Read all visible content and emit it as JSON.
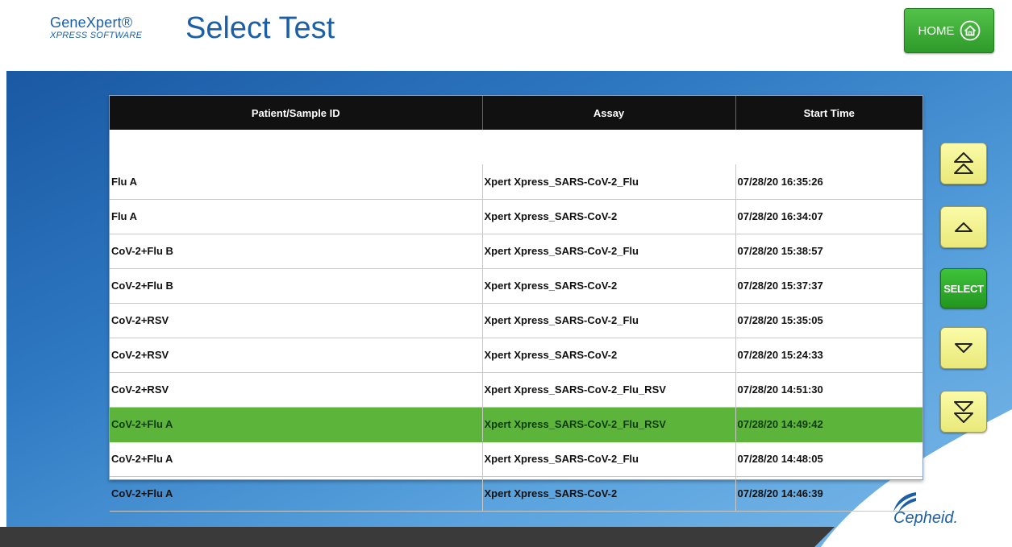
{
  "header": {
    "logo_main": "GeneXpert®",
    "logo_sub": "XPRESS SOFTWARE",
    "title": "Select Test",
    "home_label": "HOME"
  },
  "table": {
    "columns": [
      "Patient/Sample ID",
      "Assay",
      "Start Time"
    ],
    "rows": [
      {
        "id": "Flu A",
        "assay": "Xpert Xpress_SARS-CoV-2_Flu",
        "time": "07/28/20 16:35:26"
      },
      {
        "id": "Flu A",
        "assay": "Xpert Xpress_SARS-CoV-2",
        "time": "07/28/20 16:34:07"
      },
      {
        "id": "CoV-2+Flu B",
        "assay": "Xpert Xpress_SARS-CoV-2_Flu",
        "time": "07/28/20 15:38:57"
      },
      {
        "id": "CoV-2+Flu B",
        "assay": "Xpert Xpress_SARS-CoV-2",
        "time": "07/28/20 15:37:37"
      },
      {
        "id": "CoV-2+RSV",
        "assay": "Xpert Xpress_SARS-CoV-2_Flu",
        "time": "07/28/20 15:35:05"
      },
      {
        "id": "CoV-2+RSV",
        "assay": "Xpert Xpress_SARS-CoV-2",
        "time": "07/28/20 15:24:33"
      },
      {
        "id": "CoV-2+RSV",
        "assay": "Xpert Xpress_SARS-CoV-2_Flu_RSV",
        "time": "07/28/20 14:51:30"
      },
      {
        "id": "CoV-2+Flu A",
        "assay": "Xpert Xpress_SARS-CoV-2_Flu_RSV",
        "time": "07/28/20 14:49:42"
      },
      {
        "id": "CoV-2+Flu A",
        "assay": "Xpert Xpress_SARS-CoV-2_Flu",
        "time": "07/28/20 14:48:05"
      },
      {
        "id": "CoV-2+Flu A",
        "assay": "Xpert Xpress_SARS-CoV-2",
        "time": "07/28/20 14:46:39"
      }
    ],
    "selected_index": 7
  },
  "nav": {
    "select_label": "SELECT",
    "page_up_icon": "double-chevron-up-icon",
    "up_icon": "chevron-up-icon",
    "down_icon": "chevron-down-icon",
    "page_down_icon": "double-chevron-down-icon"
  },
  "footer": {
    "brand": "Cepheid."
  },
  "colors": {
    "brand_blue": "#1b5fa8",
    "selected_row": "#5cb53a",
    "home_button": "#3fae37",
    "nav_button": "#f3f38f"
  }
}
